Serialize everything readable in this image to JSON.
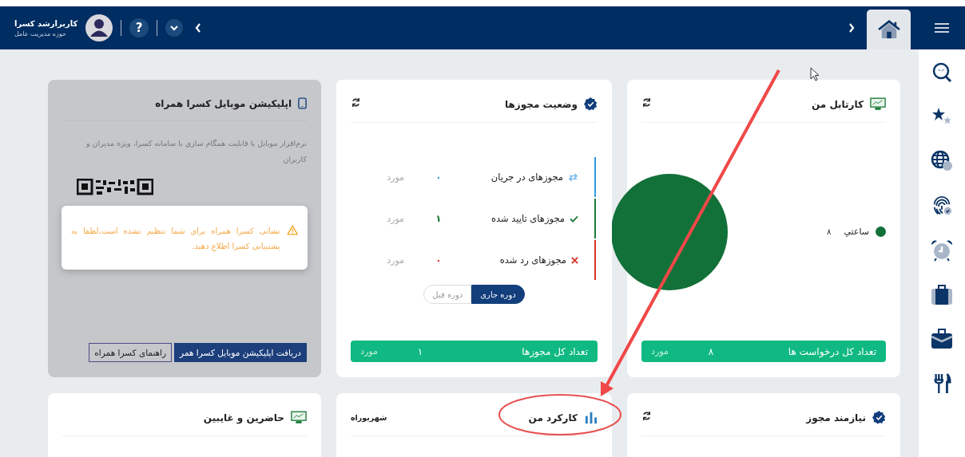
{
  "header": {
    "user_name": "کاربرارشد کسرا",
    "user_role": "حوزه مدیریت عامل",
    "help_label": "?"
  },
  "mobile_app_card": {
    "title": "اپلیکیشن موبایل کسرا همراه",
    "description": "نرم‌افزار موبایل با قابلیت همگام سازی با سامانه کسرا، ویژه مدیران و کاربران",
    "warning": "نشانی کسرا همراه برای شما تنظیم نشده است،لطفا به پشتیبانی کسرا اطلاع دهید.",
    "buttons": [
      {
        "label": "دریافت اپلیکیشن موبایل کسرا همر",
        "kind": "primary"
      },
      {
        "label": "راهنمای کسرا همراه",
        "kind": "outline"
      }
    ]
  },
  "permits_card": {
    "title": "وضعیت مجوزها",
    "rows": [
      {
        "label": "مجوزهای در جریان",
        "count": "۰",
        "unit": "مورد",
        "kind": "in_progress"
      },
      {
        "label": "مجوزهای تایید شده",
        "count": "۱",
        "unit": "مورد",
        "kind": "approved"
      },
      {
        "label": "مجوزهای رد شده",
        "count": "۰",
        "unit": "مورد",
        "kind": "rejected"
      }
    ],
    "period_tabs": [
      {
        "label": "دوره جاری",
        "selected": true
      },
      {
        "label": "دوره قبل",
        "selected": false
      }
    ],
    "total": {
      "label": "تعداد کل مجوزها",
      "count": "۱",
      "unit": "مورد"
    }
  },
  "cartable_card": {
    "title": "کارتابل من",
    "legend": [
      {
        "label": "ساعتي",
        "value": "۸",
        "color": "#127139"
      }
    ],
    "total": {
      "label": "تعداد کل درخواست ها",
      "count": "۸",
      "unit": "مورد"
    }
  },
  "bottom_cards": [
    {
      "kind": "needs_permit",
      "title": "نیازمند مجوز"
    },
    {
      "kind": "performance",
      "title": "کارکرد من",
      "period": "شهریوراه"
    },
    {
      "kind": "attendance",
      "title": "حاضرین و غایبین"
    }
  ]
}
